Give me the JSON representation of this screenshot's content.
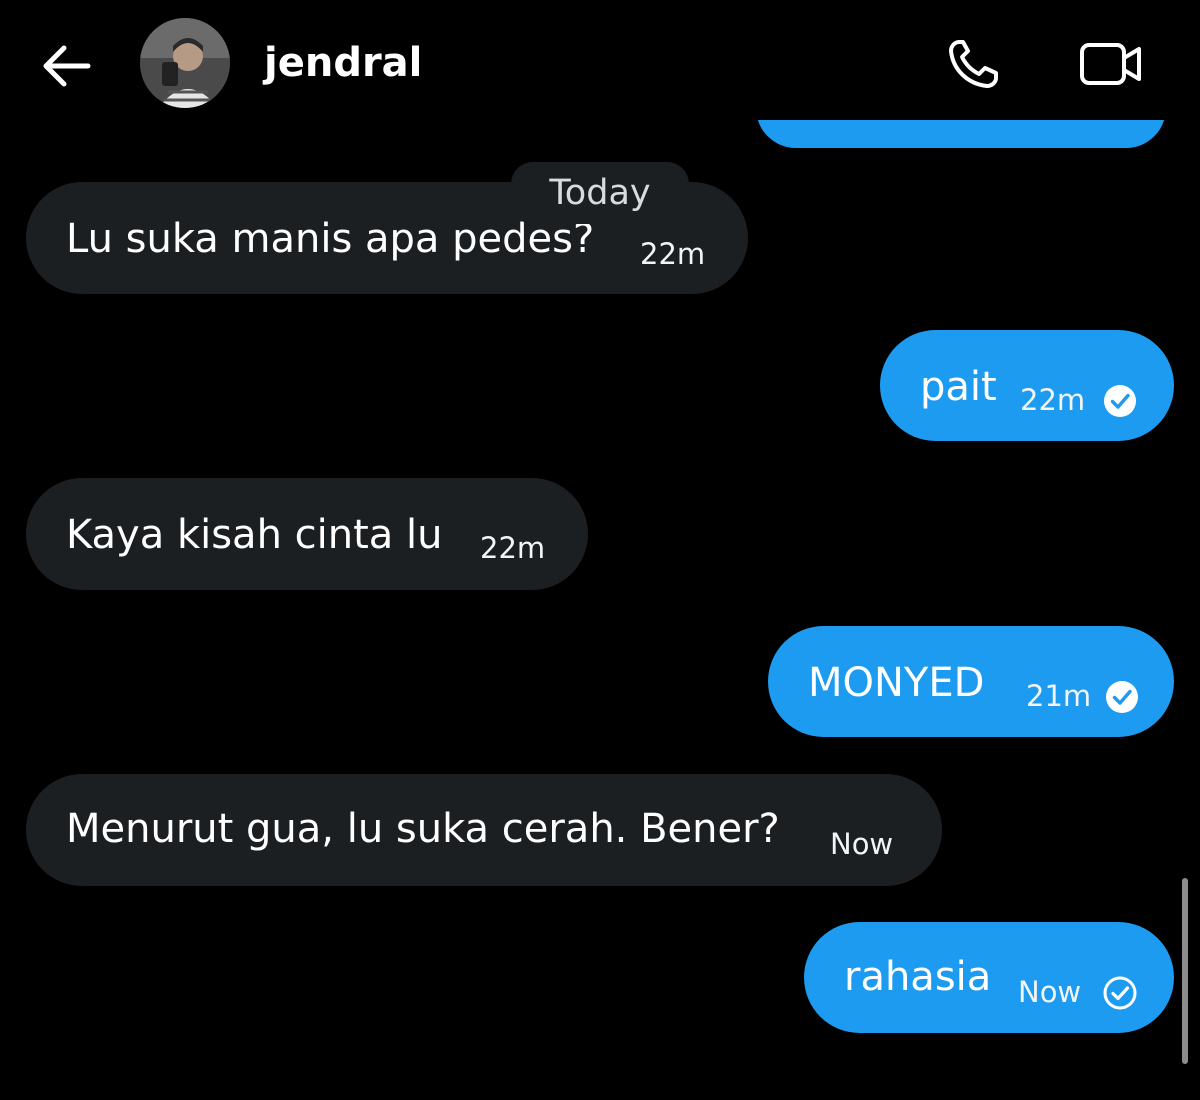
{
  "header": {
    "contact_name": "jendral",
    "back_icon": "arrow-left-icon",
    "call_icon": "phone-icon",
    "video_icon": "video-camera-icon"
  },
  "date_separator": "Today",
  "messages": [
    {
      "direction": "incoming",
      "text": "Lu suka manis apa pedes?",
      "time": "22m"
    },
    {
      "direction": "outgoing",
      "text": "pait",
      "time": "22m",
      "status": "read"
    },
    {
      "direction": "incoming",
      "text": "Kaya kisah cinta lu",
      "time": "22m"
    },
    {
      "direction": "outgoing",
      "text": "MONYED",
      "time": "21m",
      "status": "read"
    },
    {
      "direction": "incoming",
      "text": "Menurut gua, lu suka cerah. Bener?",
      "time": "Now"
    },
    {
      "direction": "outgoing",
      "text": "rahasia",
      "time": "Now",
      "status": "sent"
    }
  ],
  "colors": {
    "background": "#000000",
    "incoming_bubble": "#1c1f22",
    "outgoing_bubble": "#1d9bf0",
    "text": "#ffffff"
  }
}
